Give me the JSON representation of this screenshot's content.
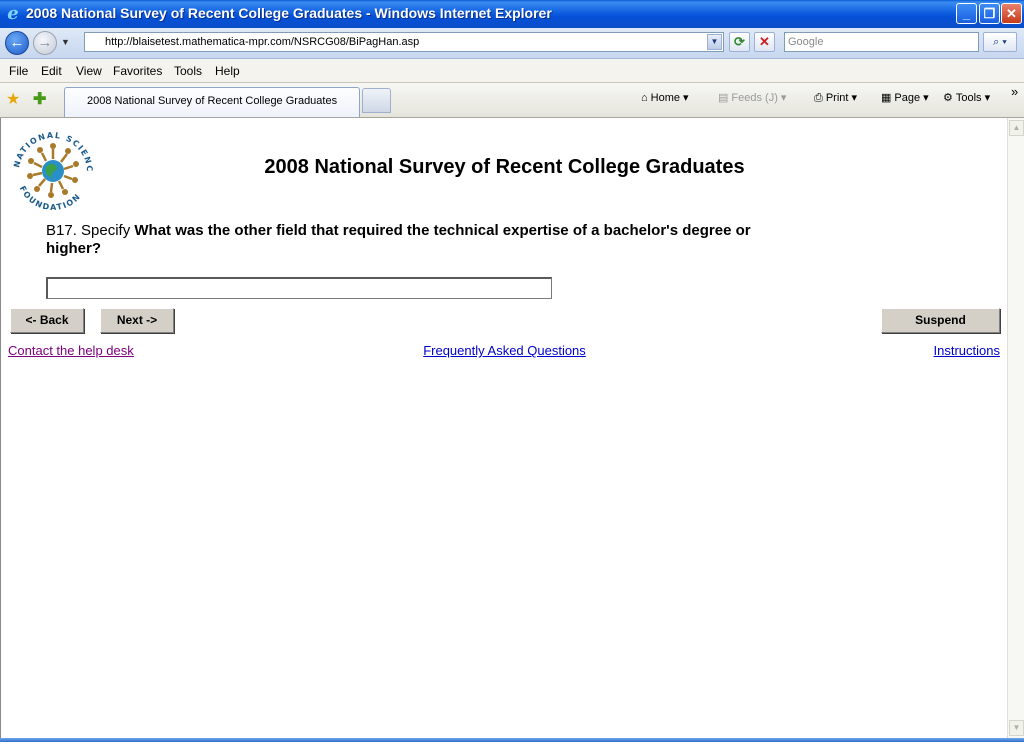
{
  "window": {
    "title": "2008 National Survey of Recent College Graduates - Windows Internet Explorer",
    "min_label": "_",
    "max_label": "❐",
    "close_label": "✕"
  },
  "address": {
    "url": "http://blaisetest.mathematica-mpr.com/NSRCG08/BiPagHan.asp",
    "search_placeholder": "Google"
  },
  "menu": {
    "items": [
      "File",
      "Edit",
      "View",
      "Favorites",
      "Tools",
      "Help"
    ]
  },
  "tabs": {
    "active_label": "2008 National Survey of Recent College Graduates"
  },
  "commands": {
    "home": "Home",
    "feeds": "Feeds (J)",
    "print": "Print",
    "page": "Page",
    "tools": "Tools",
    "more": "»"
  },
  "logo": {
    "top_text": "NATIONAL SCIENCE",
    "bottom_text": "FOUNDATION"
  },
  "page": {
    "title": "2008 National Survey of Recent College Graduates",
    "question_number": "B17. Specify ",
    "question_text": "What was the other field that required the technical expertise of a bachelor's degree or higher?",
    "answer_value": "",
    "back_label": "<- Back",
    "next_label": "Next ->",
    "suspend_label": "Suspend",
    "help_link": "Contact the help desk",
    "faq_link": "Frequently Asked Questions",
    "instructions_link": "Instructions"
  },
  "colors": {
    "titlebar": "#0550d8",
    "visited_link": "#800080",
    "link": "#0000cc"
  }
}
